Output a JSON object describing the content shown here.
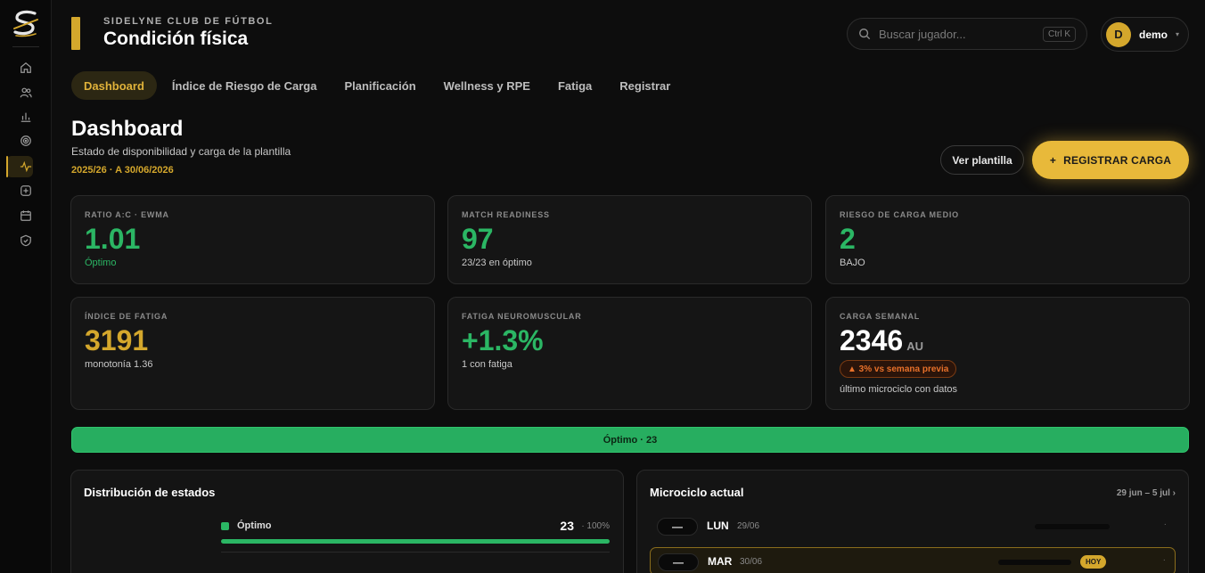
{
  "club": "SIDELYNE CLUB DE FÚTBOL",
  "section": "Condición física",
  "search": {
    "placeholder": "Buscar jugador...",
    "shortcut": "Ctrl K"
  },
  "user": {
    "initial": "D",
    "name": "demo",
    "caret": "▾"
  },
  "sidebar": {
    "icons": [
      "home-icon",
      "users-icon",
      "bar-chart-icon",
      "target-icon",
      "activity-icon",
      "plus-square-icon",
      "calendar-icon",
      "shield-icon"
    ],
    "active": "activity-icon"
  },
  "tabs": [
    {
      "label": "Dashboard",
      "active": true
    },
    {
      "label": "Índice de Riesgo de Carga",
      "active": false
    },
    {
      "label": "Planificación",
      "active": false
    },
    {
      "label": "Wellness y RPE",
      "active": false
    },
    {
      "label": "Fatiga",
      "active": false
    },
    {
      "label": "Registrar",
      "active": false
    }
  ],
  "page": {
    "title": "Dashboard",
    "subtitle": "Estado de disponibilidad y carga de la plantilla",
    "season": "2025/26 · A 30/06/2026"
  },
  "actions": {
    "roster": "Ver plantilla",
    "register_plus": "+",
    "register": "REGISTRAR CARGA"
  },
  "kpis": [
    {
      "label": "RATIO A:C · EWMA",
      "value": "1.01",
      "note": "Óptimo",
      "color": "#2bb664"
    },
    {
      "label": "MATCH READINESS",
      "value": "97",
      "note": "23/23 en óptimo",
      "color": "#2bb664"
    },
    {
      "label": "RIESGO DE CARGA MEDIO",
      "value": "2",
      "note": "BAJO",
      "color": "#2bb664"
    },
    {
      "label": "ÍNDICE DE FATIGA",
      "value": "3191",
      "note": "monotonía 1.36",
      "color": "#d4a72c"
    },
    {
      "label": "FATIGA NEUROMUSCULAR",
      "value": "+1.3%",
      "note": "1 con fatiga",
      "color": "#2bb664"
    },
    {
      "label": "CARGA SEMANAL",
      "value": "2346",
      "unit": "AU",
      "trend": "▲ 3% vs semana previa",
      "note": "último microciclo con datos",
      "color": "#ffffff"
    }
  ],
  "status_bar": {
    "label": "Óptimo · 23",
    "color": "#27ae60"
  },
  "distribution": {
    "title": "Distribución de estados",
    "rows": [
      {
        "label": "Óptimo",
        "count": "23",
        "pct": "· 100%",
        "fraction": 1.0
      }
    ]
  },
  "microcycle": {
    "title": "Microciclo actual",
    "range": "29 jun – 5 jul ›",
    "today_label": "HOY",
    "days": [
      {
        "pill": "—",
        "name": "LUN",
        "date": "29/06",
        "today": false,
        "dot": "·"
      },
      {
        "pill": "—",
        "name": "MAR",
        "date": "30/06",
        "today": true,
        "dot": "·"
      }
    ]
  }
}
